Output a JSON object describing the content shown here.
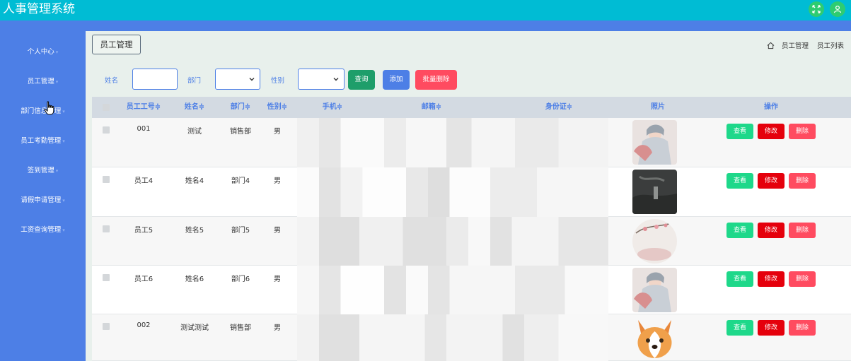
{
  "header": {
    "title": "人事管理系统",
    "icons": [
      "fullscreen-icon",
      "user-icon"
    ]
  },
  "sidebar": {
    "items": [
      {
        "label": "个人中心"
      },
      {
        "label": "员工管理"
      },
      {
        "label": "部门信息管理"
      },
      {
        "label": "员工考勤管理"
      },
      {
        "label": "签到管理"
      },
      {
        "label": "请假申请管理"
      },
      {
        "label": "工资查询管理"
      }
    ]
  },
  "main": {
    "tag": "员工管理",
    "breadcrumb": {
      "first": "员工管理",
      "second": "员工列表"
    }
  },
  "search": {
    "name_label": "姓名",
    "name_value": "",
    "dept_label": "部门",
    "dept_value": "",
    "gender_label": "性别",
    "gender_value": "",
    "query_btn": "查询",
    "add_btn": "添加",
    "batch_delete_btn": "批量删除"
  },
  "table": {
    "headers": {
      "id": "员工工号≑",
      "name": "姓名≑",
      "dept": "部门≑",
      "gender": "性别≑",
      "phone": "手机≑",
      "email": "邮箱≑",
      "idcard": "身份证≑",
      "photo": "照片",
      "ops": "操作"
    },
    "rows": [
      {
        "id": "001",
        "name": "测试",
        "dept": "销售部",
        "gender": "男",
        "photo": "portrait-fan"
      },
      {
        "id": "员工4",
        "name": "姓名4",
        "dept": "部门4",
        "gender": "男",
        "photo": "dark-landscape"
      },
      {
        "id": "员工5",
        "name": "姓名5",
        "dept": "部门5",
        "gender": "男",
        "photo": "plum-blossom"
      },
      {
        "id": "员工6",
        "name": "姓名6",
        "dept": "部门6",
        "gender": "男",
        "photo": "portrait-fan"
      },
      {
        "id": "002",
        "name": "测试测试",
        "dept": "销售部",
        "gender": "男",
        "photo": "corgi"
      }
    ],
    "action_labels": {
      "view": "查看",
      "edit": "修改",
      "delete": "删除"
    }
  },
  "colors": {
    "topbar": "#00bcd4",
    "sidebar": "#4d7fe6",
    "query": "#1e9e6a",
    "add": "#4d7fe6",
    "batch_delete": "#ff4b60",
    "view": "#1ed88a",
    "edit": "#e5000c",
    "delete": "#ff4b60"
  }
}
